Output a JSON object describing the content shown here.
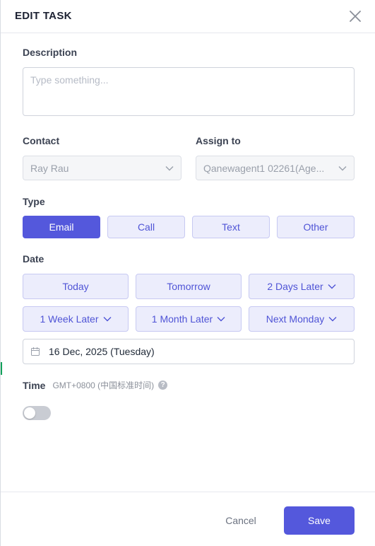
{
  "header": {
    "title": "EDIT TASK",
    "close_icon": "close-icon"
  },
  "description": {
    "label": "Description",
    "placeholder": "Type something..."
  },
  "contact": {
    "label": "Contact",
    "value": "Ray Rau"
  },
  "assign": {
    "label": "Assign to",
    "value": "Qanewagent1 02261(Age..."
  },
  "type": {
    "label": "Type",
    "options": [
      "Email",
      "Call",
      "Text",
      "Other"
    ],
    "selected": "Email"
  },
  "date": {
    "label": "Date",
    "quick": [
      "Today",
      "Tomorrow",
      "2 Days Later",
      "1 Week Later",
      "1 Month Later",
      "Next Monday"
    ],
    "value": "16 Dec, 2025 (Tuesday)"
  },
  "time": {
    "label": "Time",
    "timezone": "GMT+0800 (中国标准时间)",
    "help": "?",
    "enabled": false
  },
  "footer": {
    "cancel_label": "Cancel",
    "save_label": "Save"
  },
  "colors": {
    "accent": "#5458dc",
    "accent_light": "#ecedfc",
    "border": "#cfd3dc"
  }
}
